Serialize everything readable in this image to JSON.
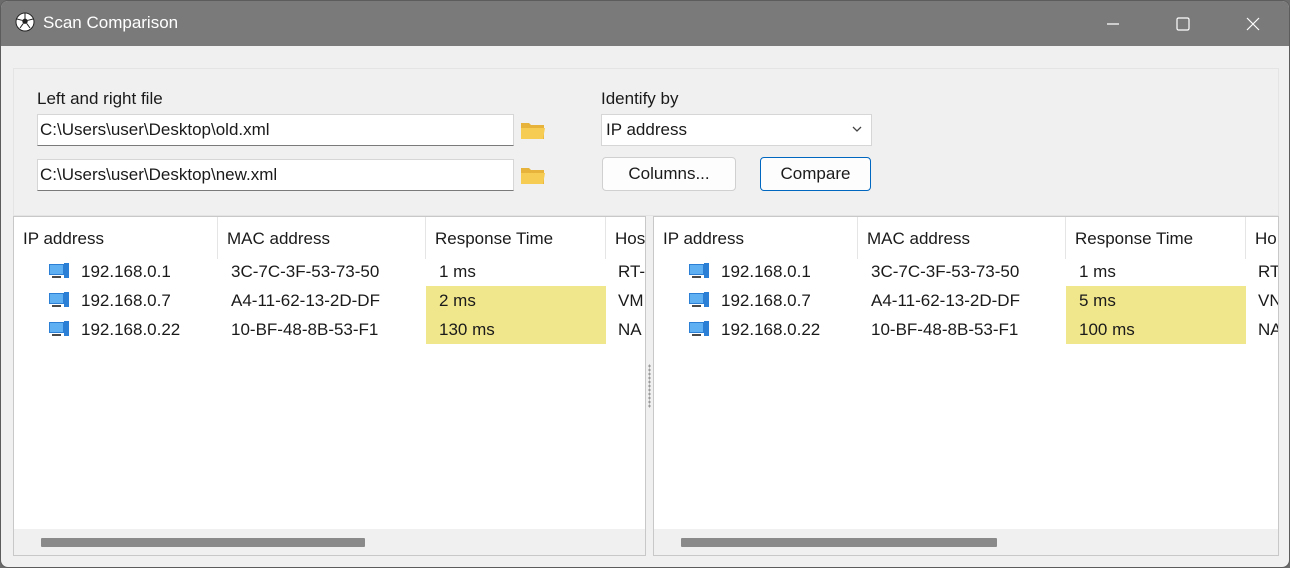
{
  "window": {
    "title": "Scan Comparison",
    "app_icon": "soccer-ball-icon"
  },
  "files": {
    "label": "Left and right file",
    "left_path": "C:\\Users\\user\\Desktop\\old.xml",
    "right_path": "C:\\Users\\user\\Desktop\\new.xml"
  },
  "identify": {
    "label": "Identify by",
    "selected": "IP address"
  },
  "buttons": {
    "columns": "Columns...",
    "compare": "Compare"
  },
  "colors": {
    "highlight": "#f0e68c",
    "accent": "#0067c0",
    "titlebar": "#7a7a7a"
  },
  "left_table": {
    "headers": [
      "IP address",
      "MAC address",
      "Response Time",
      "Hostname"
    ],
    "header_visible": [
      "IP address",
      "MAC address",
      "Response Time",
      "Hos"
    ],
    "rows": [
      {
        "ip": "192.168.0.1",
        "mac": "3C-7C-3F-53-73-50",
        "time": "1 ms",
        "host": "RT-",
        "changed": false
      },
      {
        "ip": "192.168.0.7",
        "mac": "A4-11-62-13-2D-DF",
        "time": "2 ms",
        "host": "VM",
        "changed": true
      },
      {
        "ip": "192.168.0.22",
        "mac": "10-BF-48-8B-53-F1",
        "time": "130 ms",
        "host": "NA",
        "changed": true
      }
    ]
  },
  "right_table": {
    "headers": [
      "IP address",
      "MAC address",
      "Response Time",
      "Hostname"
    ],
    "header_visible": [
      "IP address",
      "MAC address",
      "Response Time",
      "Ho"
    ],
    "rows": [
      {
        "ip": "192.168.0.1",
        "mac": "3C-7C-3F-53-73-50",
        "time": "1 ms",
        "host": "RT",
        "changed": false
      },
      {
        "ip": "192.168.0.7",
        "mac": "A4-11-62-13-2D-DF",
        "time": "5 ms",
        "host": "VN",
        "changed": true
      },
      {
        "ip": "192.168.0.22",
        "mac": "10-BF-48-8B-53-F1",
        "time": "100 ms",
        "host": "NA",
        "changed": true
      }
    ]
  }
}
